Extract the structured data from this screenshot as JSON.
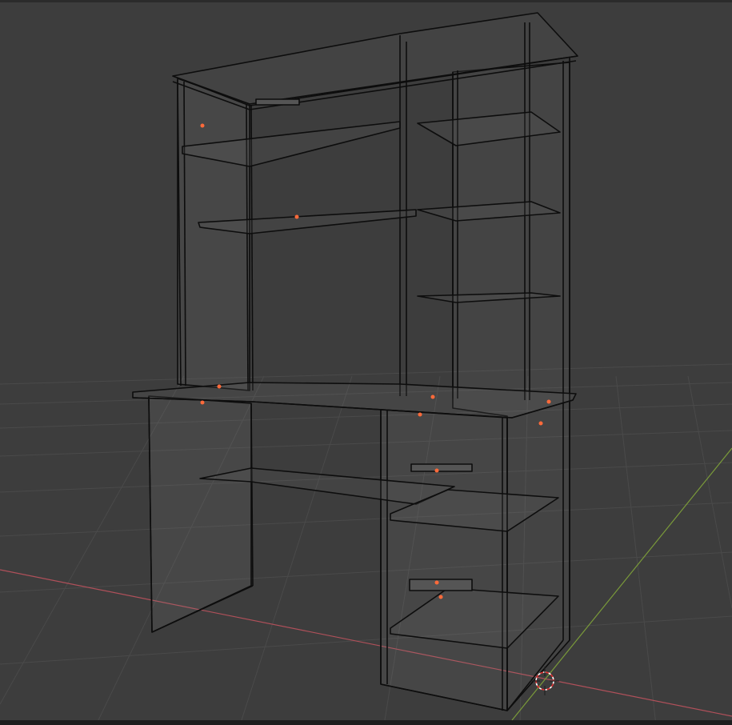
{
  "viewport": {
    "background": "#3d3d3d",
    "grid_color": "#4a4a4a",
    "x_axis_color": "#b0505a",
    "y_axis_color": "#7a9a3a",
    "wire_color": "#0d0d0d",
    "object_fill": "#8a8a8a",
    "origin_color": "#ff6a3a",
    "cursor_icon": "3d-cursor-icon"
  }
}
